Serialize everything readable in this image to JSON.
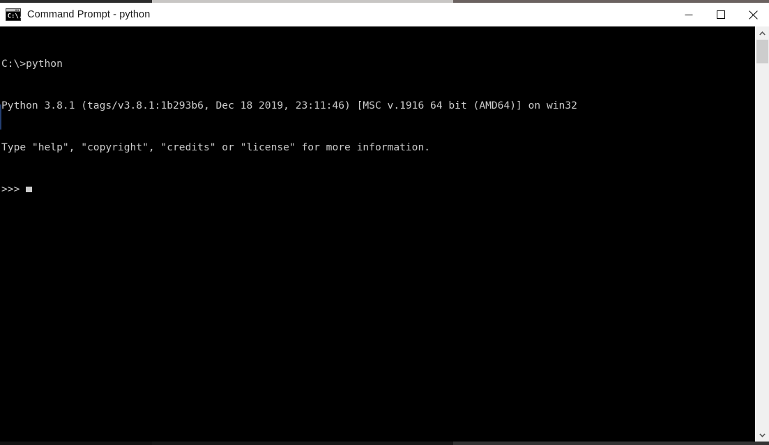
{
  "window": {
    "title": "Command Prompt - python",
    "icon": "command-prompt-icon",
    "icon_text": "C:\\",
    "controls": {
      "minimize_label": "Minimize",
      "maximize_label": "Maximize",
      "close_label": "Close"
    }
  },
  "console": {
    "background_color": "#000000",
    "foreground_color": "#cccccc",
    "lines": [
      "C:\\>python",
      "Python 3.8.1 (tags/v3.8.1:1b293b6, Dec 18 2019, 23:11:46) [MSC v.1916 64 bit (AMD64)] on win32",
      "Type \"help\", \"copyright\", \"credits\" or \"license\" for more information."
    ],
    "prompt": ">>>",
    "cursor": "block"
  },
  "scrollbar": {
    "up_arrow": "chevron-up-icon",
    "down_arrow": "chevron-down-icon",
    "thumb_position_percent": 0,
    "thumb_size_percent": 6
  }
}
